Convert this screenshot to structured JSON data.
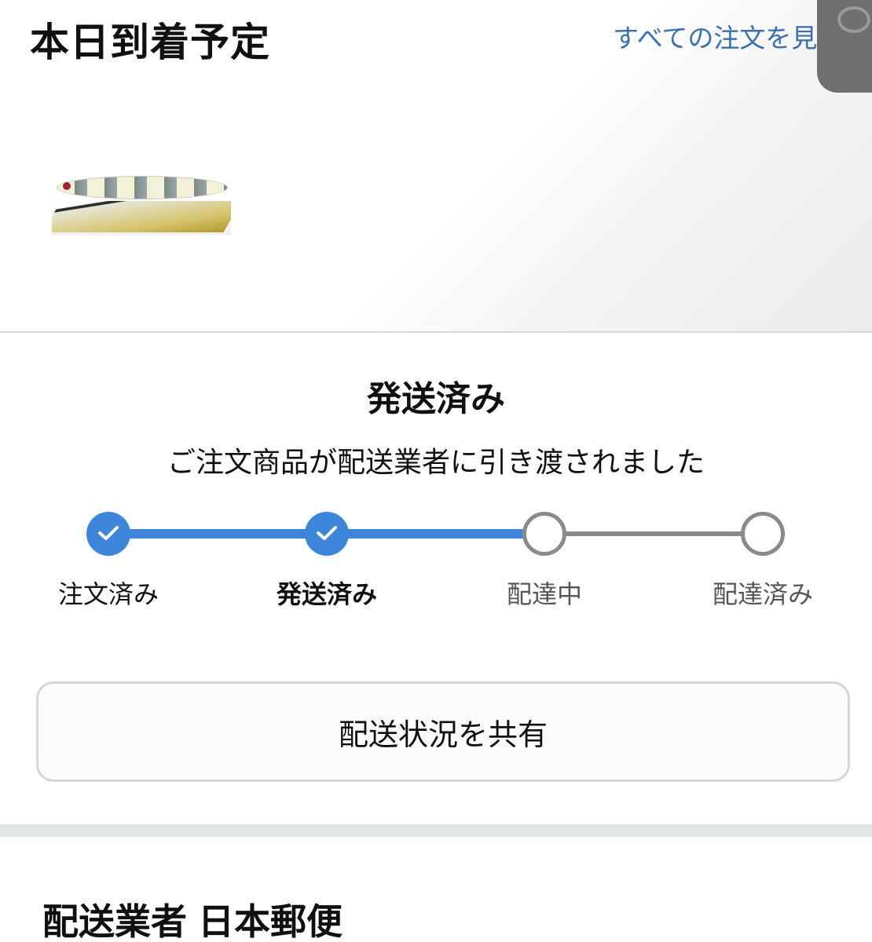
{
  "header": {
    "title": "本日到着予定",
    "all_orders_link": "すべての注文を見る"
  },
  "product": {
    "image_icon": "fishing-lure-product-image"
  },
  "shipment": {
    "status_title": "発送済み",
    "status_description": "ご注文商品が配送業者に引き渡されました",
    "progress": {
      "current_step_index": 1,
      "steps": [
        {
          "label": "注文済み",
          "state": "done"
        },
        {
          "label": "発送済み",
          "state": "current"
        },
        {
          "label": "配達中",
          "state": "pending"
        },
        {
          "label": "配達済み",
          "state": "pending"
        }
      ]
    },
    "share_button_label": "配送状況を共有"
  },
  "carrier": {
    "label": "配送業者",
    "name": "日本郵便"
  },
  "colors": {
    "accent": "#3e86dc",
    "link": "#3a6fb0",
    "inactive": "#8a8a8a",
    "text": "#0f1111"
  }
}
